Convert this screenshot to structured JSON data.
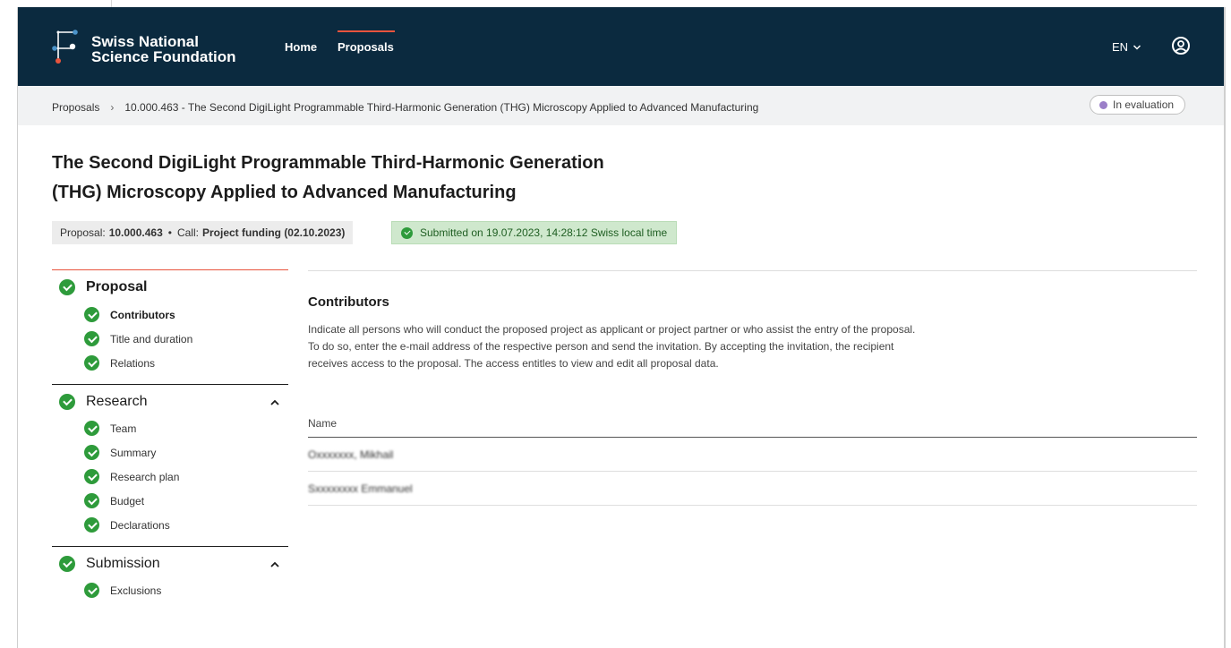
{
  "header": {
    "brand_line1": "Swiss National",
    "brand_line2": "Science Foundation",
    "nav": [
      {
        "label": "Home",
        "active": false
      },
      {
        "label": "Proposals",
        "active": true
      }
    ],
    "language": "EN",
    "accent_color": "#e8543d",
    "bar_color": "#0b2a3f"
  },
  "breadcrumb": {
    "root": "Proposals",
    "separator": "›",
    "current": "10.000.463 - The Second DigiLight Programmable Third-Harmonic Generation (THG) Microscopy Applied to Advanced Manufacturing",
    "status": "In evaluation"
  },
  "proposal": {
    "title_line1": "The Second DigiLight Programmable Third-Harmonic Generation",
    "title_line2": "(THG) Microscopy Applied to Advanced Manufacturing",
    "proposal_label": "Proposal:",
    "proposal_number": "10.000.463",
    "separator": "•",
    "call_label": "Call:",
    "call_name": "Project funding (02.10.2023)",
    "submitted": "Submitted on 19.07.2023, 14:28:12 Swiss local time"
  },
  "sidebar": {
    "sections": [
      {
        "label": "Proposal",
        "items": [
          "Contributors",
          "Title and duration",
          "Relations"
        ]
      },
      {
        "label": "Research",
        "items": [
          "Team",
          "Summary",
          "Research plan",
          "Budget",
          "Declarations"
        ]
      },
      {
        "label": "Submission",
        "items": [
          "Exclusions"
        ]
      }
    ],
    "active_item": "Contributors"
  },
  "content": {
    "heading": "Contributors",
    "description_line1": "Indicate all persons who will conduct the proposed project as applicant or project partner or who assist the entry of the proposal.",
    "description_line2": "To do so, enter the e-mail address of the respective person and send the invitation. By accepting the invitation, the recipient",
    "description_line3": "receives access to the proposal. The access entitles to view and edit all proposal data.",
    "table": {
      "column_name": "Name",
      "rows": [
        "Oxxxxxxx, Mikhail",
        "Sxxxxxxxx Emmanuel"
      ]
    }
  }
}
